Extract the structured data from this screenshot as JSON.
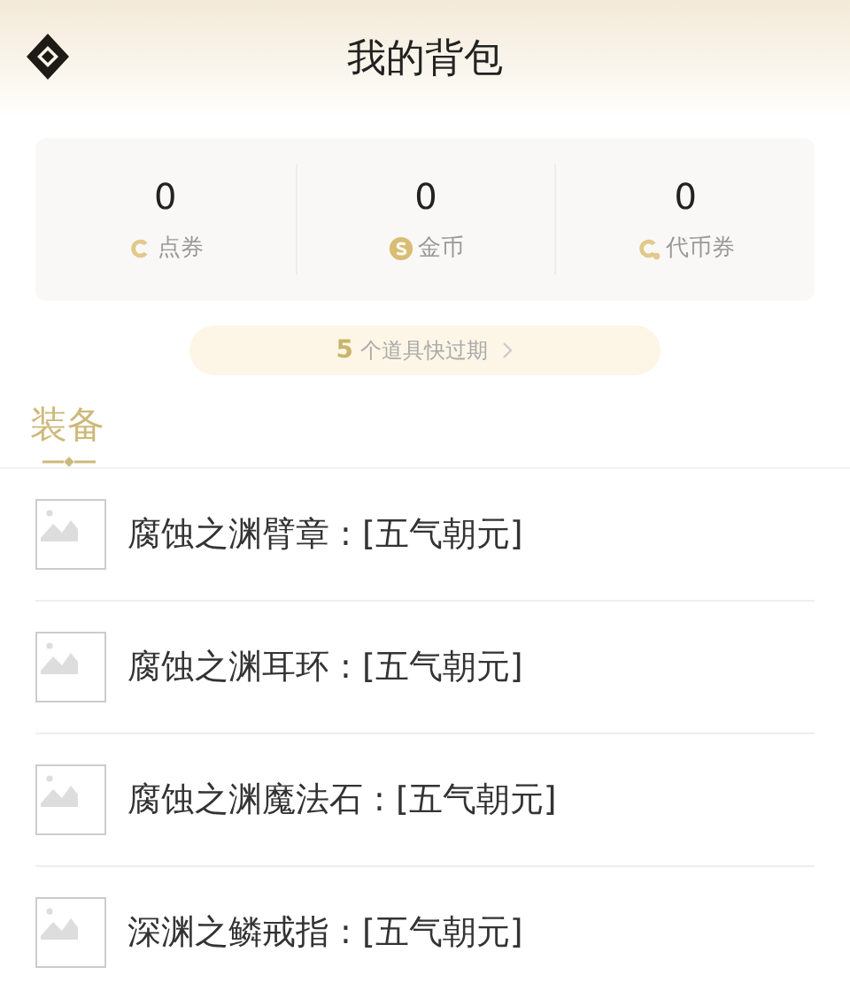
{
  "header": {
    "title": "我的背包"
  },
  "balances": [
    {
      "value": "0",
      "label": "点券",
      "kind": "coupon"
    },
    {
      "value": "0",
      "label": "金币",
      "kind": "gold"
    },
    {
      "value": "0",
      "label": "代币券",
      "kind": "token"
    }
  ],
  "expiring_notice": "**5** 个道具快过期",
  "section": {
    "title": "装备"
  },
  "items": [
    {
      "name": "腐蚀之渊臂章 : [五气朝元]"
    },
    {
      "name": "腐蚀之渊耳环 : [五气朝元]"
    },
    {
      "name": "腐蚀之渊魔法石 : [五气朝元]"
    },
    {
      "name": "深渊之鳞戒指 : [五气朝元]"
    }
  ]
}
